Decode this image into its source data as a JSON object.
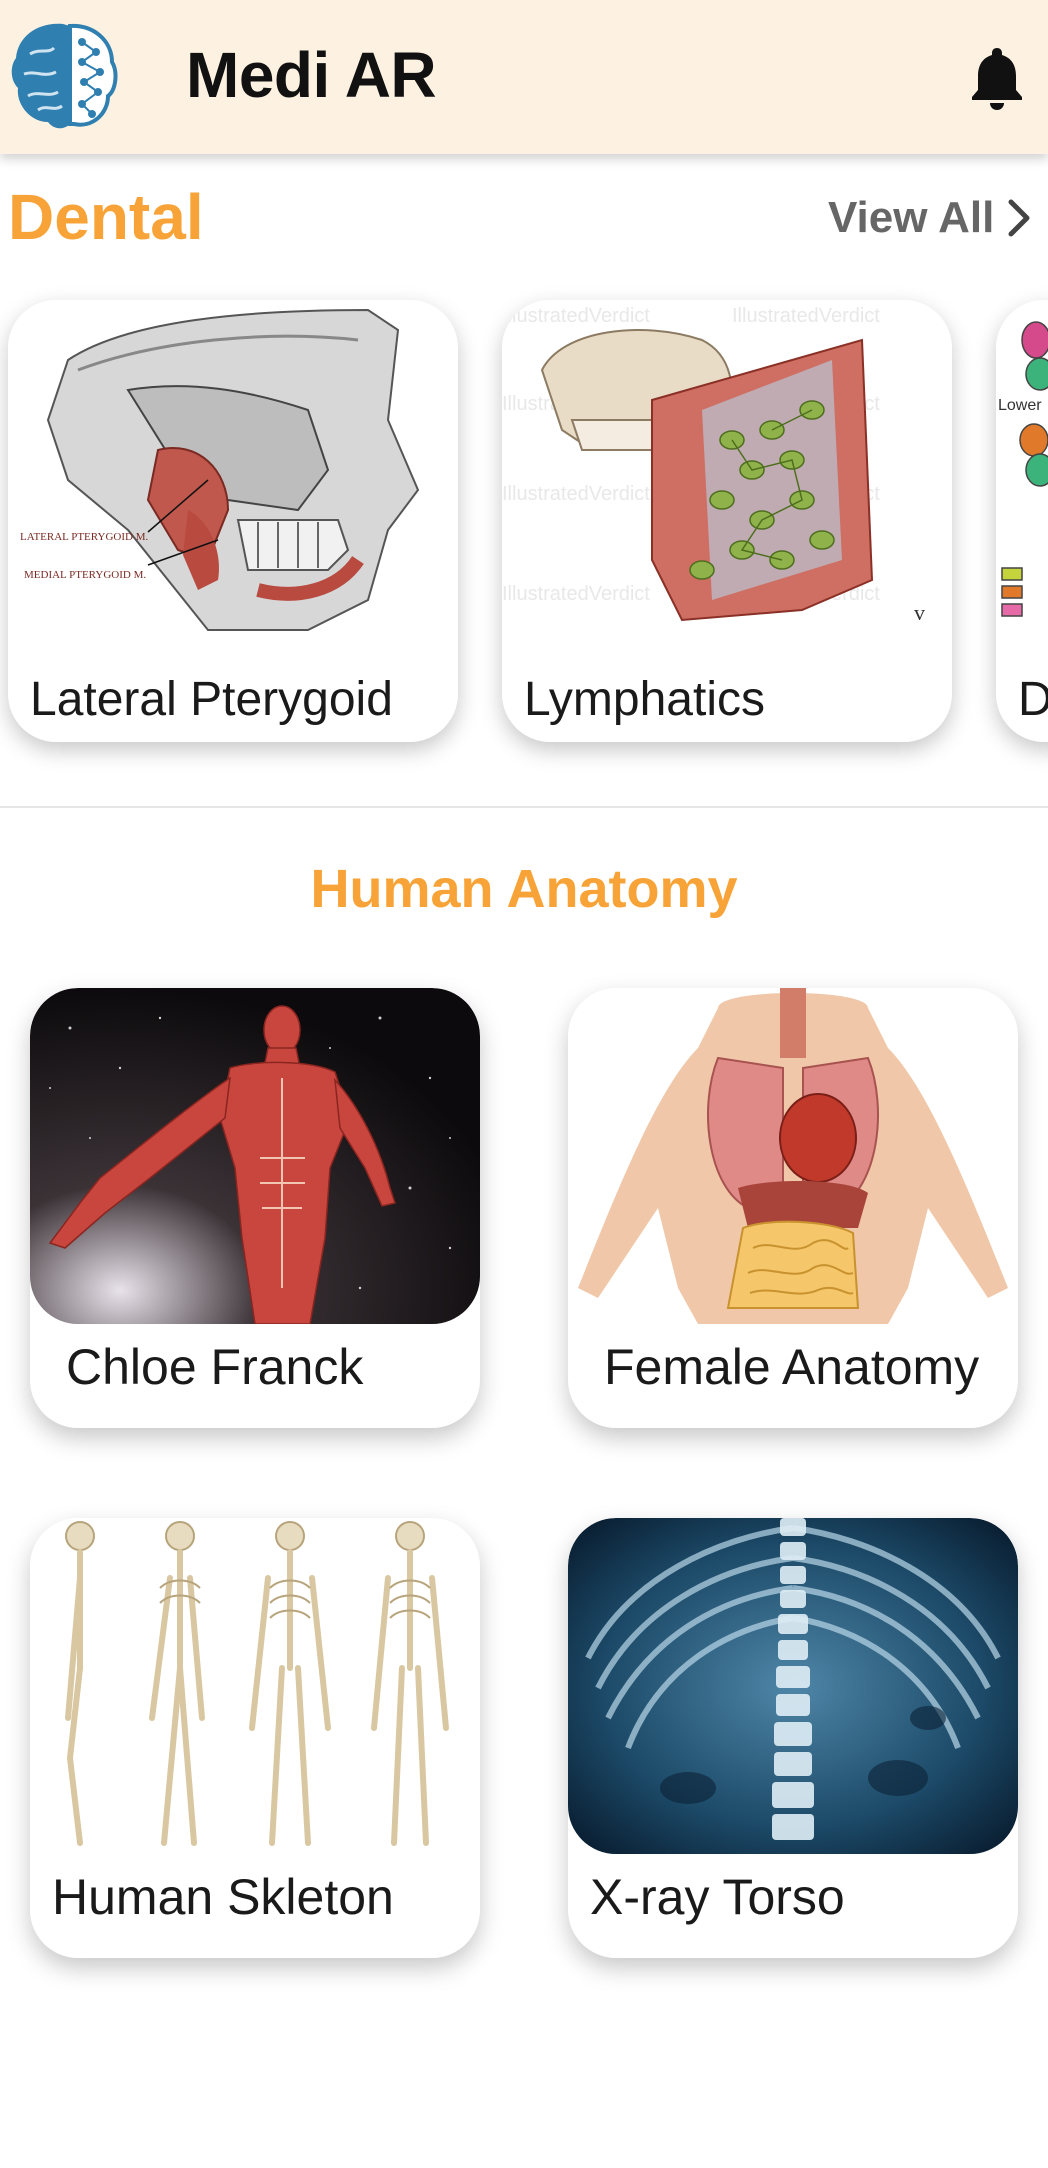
{
  "app": {
    "title": "Medi AR"
  },
  "dental": {
    "title": "Dental",
    "view_all_label": "View All",
    "cards": [
      {
        "caption": "Lateral Pterygoid",
        "image_labels": [
          "LATERAL PTERYGOID M.",
          "MEDIAL PTERYGOID M."
        ]
      },
      {
        "caption": "Lymphatics",
        "watermark": "IllustratedVerdict"
      },
      {
        "caption": "D",
        "image_label": "Lower"
      }
    ]
  },
  "anatomy": {
    "title": "Human Anatomy",
    "cards": [
      {
        "caption": "Chloe Franck"
      },
      {
        "caption": "Female Anatomy"
      },
      {
        "caption": "Human Skleton"
      },
      {
        "caption": "X-ray Torso"
      }
    ]
  },
  "colors": {
    "accent": "#f7a337",
    "appbar_bg": "#fdf2e2",
    "logo_blue": "#2f7fb0"
  },
  "icons": {
    "logo": "brain-circuit-logo-icon",
    "notifications": "bell-icon",
    "view_all": "chevron-right-icon"
  }
}
